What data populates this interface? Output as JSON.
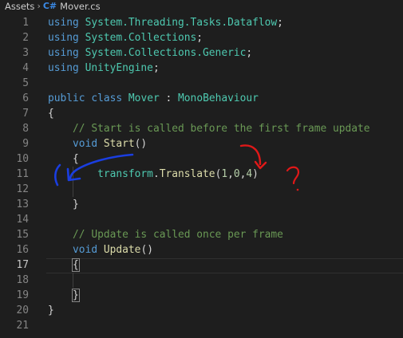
{
  "breadcrumb": {
    "folder": "Assets",
    "lang_badge": "C#",
    "file": "Mover.cs"
  },
  "editor": {
    "active_line": 17,
    "lines": [
      {
        "n": "1",
        "tokens": [
          {
            "t": "using",
            "c": "kw"
          },
          {
            "t": " ",
            "c": "txt"
          },
          {
            "t": "System.Threading.Tasks.Dataflow",
            "c": "ty"
          },
          {
            "t": ";",
            "c": "txt"
          }
        ]
      },
      {
        "n": "2",
        "tokens": [
          {
            "t": "using",
            "c": "kw"
          },
          {
            "t": " ",
            "c": "txt"
          },
          {
            "t": "System.Collections",
            "c": "ty"
          },
          {
            "t": ";",
            "c": "txt"
          }
        ]
      },
      {
        "n": "3",
        "tokens": [
          {
            "t": "using",
            "c": "kw"
          },
          {
            "t": " ",
            "c": "txt"
          },
          {
            "t": "System.Collections.Generic",
            "c": "ty"
          },
          {
            "t": ";",
            "c": "txt"
          }
        ]
      },
      {
        "n": "4",
        "tokens": [
          {
            "t": "using",
            "c": "kw"
          },
          {
            "t": " ",
            "c": "txt"
          },
          {
            "t": "UnityEngine",
            "c": "ty"
          },
          {
            "t": ";",
            "c": "txt"
          }
        ]
      },
      {
        "n": "5",
        "tokens": []
      },
      {
        "n": "6",
        "tokens": [
          {
            "t": "public",
            "c": "kw"
          },
          {
            "t": " ",
            "c": "txt"
          },
          {
            "t": "class",
            "c": "kw"
          },
          {
            "t": " ",
            "c": "txt"
          },
          {
            "t": "Mover",
            "c": "ty"
          },
          {
            "t": " : ",
            "c": "txt"
          },
          {
            "t": "MonoBehaviour",
            "c": "ty"
          }
        ]
      },
      {
        "n": "7",
        "tokens": [
          {
            "t": "{",
            "c": "txt"
          }
        ]
      },
      {
        "n": "8",
        "tokens": [
          {
            "t": "    ",
            "c": "txt"
          },
          {
            "t": "// Start is called before the first frame update",
            "c": "cm"
          }
        ]
      },
      {
        "n": "9",
        "tokens": [
          {
            "t": "    ",
            "c": "txt"
          },
          {
            "t": "void",
            "c": "kw"
          },
          {
            "t": " ",
            "c": "txt"
          },
          {
            "t": "Start",
            "c": "fn"
          },
          {
            "t": "()",
            "c": "txt"
          }
        ]
      },
      {
        "n": "10",
        "tokens": [
          {
            "t": "    ",
            "c": "txt"
          },
          {
            "t": "{",
            "c": "txt"
          }
        ]
      },
      {
        "n": "11",
        "tokens": [
          {
            "t": "        ",
            "c": "txt"
          },
          {
            "t": "transform",
            "c": "ty"
          },
          {
            "t": ".",
            "c": "txt"
          },
          {
            "t": "Translate",
            "c": "fn"
          },
          {
            "t": "(",
            "c": "txt"
          },
          {
            "t": "1",
            "c": "num"
          },
          {
            "t": ",",
            "c": "txt"
          },
          {
            "t": "0",
            "c": "num"
          },
          {
            "t": ",",
            "c": "txt"
          },
          {
            "t": "4",
            "c": "num"
          },
          {
            "t": ")",
            "c": "txt"
          }
        ]
      },
      {
        "n": "12",
        "tokens": []
      },
      {
        "n": "13",
        "tokens": [
          {
            "t": "    ",
            "c": "txt"
          },
          {
            "t": "}",
            "c": "txt"
          }
        ]
      },
      {
        "n": "14",
        "tokens": []
      },
      {
        "n": "15",
        "tokens": [
          {
            "t": "    ",
            "c": "txt"
          },
          {
            "t": "// Update is called once per frame",
            "c": "cm"
          }
        ]
      },
      {
        "n": "16",
        "tokens": [
          {
            "t": "    ",
            "c": "txt"
          },
          {
            "t": "void",
            "c": "kw"
          },
          {
            "t": " ",
            "c": "txt"
          },
          {
            "t": "Update",
            "c": "fn"
          },
          {
            "t": "()",
            "c": "txt"
          }
        ]
      },
      {
        "n": "17",
        "tokens": [
          {
            "t": "    ",
            "c": "txt"
          },
          {
            "t": "{",
            "c": "txt",
            "box": true
          }
        ]
      },
      {
        "n": "18",
        "tokens": []
      },
      {
        "n": "19",
        "tokens": [
          {
            "t": "    ",
            "c": "txt"
          },
          {
            "t": "}",
            "c": "txt",
            "box": true
          }
        ]
      },
      {
        "n": "20",
        "tokens": [
          {
            "t": "}",
            "c": "txt"
          }
        ]
      },
      {
        "n": "21",
        "tokens": []
      }
    ]
  },
  "annotations": {
    "blue_ink_color": "#1a3ee0",
    "red_ink_color": "#e01818",
    "question_mark": "?"
  }
}
